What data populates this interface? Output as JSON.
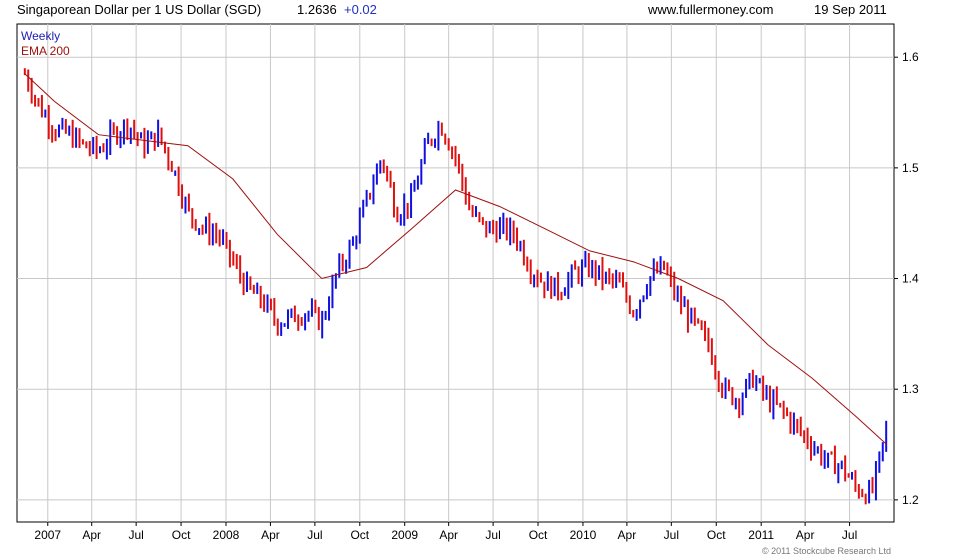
{
  "header": {
    "title": "Singaporean Dollar per 1 US Dollar (SGD)",
    "last_price": "1.2636",
    "change": "+0.02",
    "site": "www.fullermoney.com",
    "date": "19 Sep 2011"
  },
  "legend": {
    "interval": "Weekly",
    "indicator": "EMA 200"
  },
  "copyright": "© 2011 Stockcube Research Ltd",
  "colors": {
    "up_bar": "#1010e0",
    "down_bar": "#e01010",
    "ema_line": "#a01010",
    "grid": "#c8c8c8",
    "axis": "#000000"
  },
  "chart_data": {
    "type": "line",
    "title": "Singaporean Dollar per 1 US Dollar (SGD)",
    "series_style": "weekly high-low bars (blue = up week, red = down week) with EMA 200 line",
    "x_ticks": [
      "2007",
      "Apr",
      "Jul",
      "Oct",
      "2008",
      "Apr",
      "Jul",
      "Oct",
      "2009",
      "Apr",
      "Jul",
      "Oct",
      "2010",
      "Apr",
      "Jul",
      "Oct",
      "2011",
      "Apr",
      "Jul"
    ],
    "y_ticks": [
      1.2,
      1.3,
      1.4,
      1.5,
      1.6
    ],
    "ylim": [
      1.18,
      1.63
    ],
    "xlim": [
      "2006-10-30",
      "2011-09-30"
    ],
    "grid": true,
    "legend_position": "top-left",
    "series": [
      {
        "name": "Weekly",
        "x": [
          "2006-11",
          "2006-12",
          "2007-01",
          "2007-02",
          "2007-03",
          "2007-04",
          "2007-05",
          "2007-06",
          "2007-07",
          "2007-08",
          "2007-09",
          "2007-10",
          "2007-11",
          "2007-12",
          "2008-01",
          "2008-02",
          "2008-03",
          "2008-04",
          "2008-05",
          "2008-06",
          "2008-07",
          "2008-08",
          "2008-09",
          "2008-10",
          "2008-11",
          "2008-12",
          "2009-01",
          "2009-02",
          "2009-03",
          "2009-04",
          "2009-05",
          "2009-06",
          "2009-07",
          "2009-08",
          "2009-09",
          "2009-10",
          "2009-11",
          "2009-12",
          "2010-01",
          "2010-02",
          "2010-03",
          "2010-04",
          "2010-05",
          "2010-06",
          "2010-07",
          "2010-08",
          "2010-09",
          "2010-10",
          "2010-11",
          "2010-12",
          "2011-01",
          "2011-02",
          "2011-03",
          "2011-04",
          "2011-05",
          "2011-06",
          "2011-07",
          "2011-08",
          "2011-09"
        ],
        "y": [
          1.585,
          1.555,
          1.535,
          1.53,
          1.52,
          1.515,
          1.53,
          1.54,
          1.52,
          1.53,
          1.5,
          1.46,
          1.445,
          1.44,
          1.415,
          1.39,
          1.38,
          1.36,
          1.365,
          1.37,
          1.36,
          1.405,
          1.43,
          1.47,
          1.51,
          1.46,
          1.47,
          1.52,
          1.54,
          1.51,
          1.46,
          1.445,
          1.445,
          1.44,
          1.41,
          1.395,
          1.39,
          1.405,
          1.41,
          1.4,
          1.395,
          1.37,
          1.4,
          1.41,
          1.38,
          1.36,
          1.34,
          1.3,
          1.29,
          1.31,
          1.29,
          1.28,
          1.265,
          1.25,
          1.235,
          1.23,
          1.21,
          1.205,
          1.2636
        ]
      },
      {
        "name": "EMA 200",
        "x": [
          "2006-11",
          "2007-01",
          "2007-04",
          "2007-07",
          "2007-10",
          "2008-01",
          "2008-04",
          "2008-07",
          "2008-10",
          "2009-01",
          "2009-04",
          "2009-07",
          "2009-10",
          "2010-01",
          "2010-04",
          "2010-07",
          "2010-10",
          "2011-01",
          "2011-04",
          "2011-07",
          "2011-09"
        ],
        "y": [
          1.585,
          1.56,
          1.53,
          1.525,
          1.52,
          1.49,
          1.44,
          1.4,
          1.41,
          1.445,
          1.48,
          1.465,
          1.445,
          1.425,
          1.415,
          1.4,
          1.38,
          1.34,
          1.31,
          1.275,
          1.25
        ]
      }
    ]
  }
}
